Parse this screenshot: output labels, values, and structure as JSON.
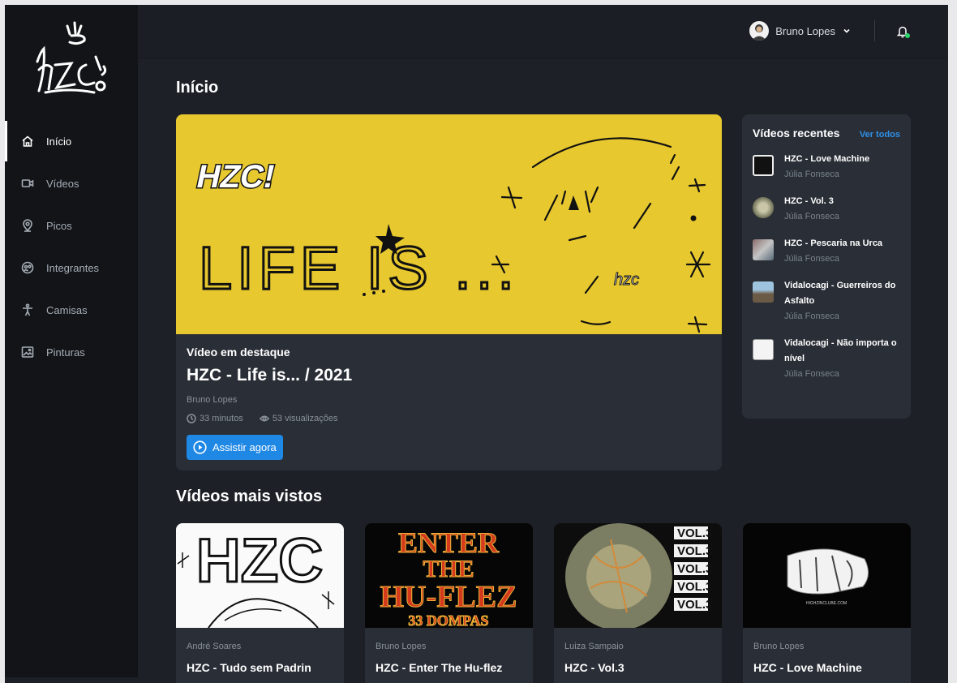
{
  "brand": {
    "logo_text": "hzc"
  },
  "sidebar": {
    "items": [
      {
        "label": "Início",
        "icon": "home-icon",
        "active": true
      },
      {
        "label": "Vídeos",
        "icon": "video-camera-icon",
        "active": false
      },
      {
        "label": "Picos",
        "icon": "map-pin-icon",
        "active": false
      },
      {
        "label": "Integrantes",
        "icon": "group-icon",
        "active": false
      },
      {
        "label": "Camisas",
        "icon": "person-icon",
        "active": false
      },
      {
        "label": "Pinturas",
        "icon": "image-icon",
        "active": false
      }
    ]
  },
  "header": {
    "user_name": "Bruno Lopes",
    "notification_indicator_color": "#2bd46a"
  },
  "main": {
    "title": "Início",
    "featured": {
      "kicker": "Vídeo em destaque",
      "title": "HZC - Life is... / 2021",
      "author": "Bruno Lopes",
      "duration": "33 minutos",
      "views": "53 visualizações",
      "button_label": "Assistir agora",
      "banner_text": "LIFE IS ...",
      "banner_logo": "HZC!",
      "banner_color": "#e7c82f"
    },
    "recent": {
      "title": "Vídeos recentes",
      "see_all": "Ver todos",
      "items": [
        {
          "title": "HZC - Love Machine",
          "author": "Júlia Fonseca"
        },
        {
          "title": "HZC - Vol. 3",
          "author": "Júlia Fonseca"
        },
        {
          "title": "HZC - Pescaria na Urca",
          "author": "Júlia Fonseca"
        },
        {
          "title": "Vidalocagi - Guerreiros do Asfalto",
          "author": "Júlia Fonseca"
        },
        {
          "title": "Vidalocagi - Não importa o nível",
          "author": "Júlia Fonseca"
        }
      ]
    },
    "most_viewed": {
      "title": "Vídeos mais vistos",
      "cards": [
        {
          "author": "André Soares",
          "title": "HZC - Tudo sem Padrin",
          "thumb_text": "HZC"
        },
        {
          "author": "Bruno Lopes",
          "title": "HZC - Enter The Hu-flez",
          "thumb_lines": [
            "ENTER",
            "THE",
            "HU-FLEZ"
          ],
          "thumb_footer": "33 DOMPAS"
        },
        {
          "author": "Luiza Sampaio",
          "title": "HZC - Vol.3",
          "thumb_text": "VOL.3"
        },
        {
          "author": "Bruno Lopes",
          "title": "HZC - Love Machine",
          "thumb_caption": "HIGHZINCLUBE.COM"
        }
      ]
    }
  },
  "colors": {
    "accent": "#1f88e5",
    "link": "#2f90e8",
    "background": "#1d2127",
    "sidebar": "#121417",
    "card": "#2a2f37"
  }
}
